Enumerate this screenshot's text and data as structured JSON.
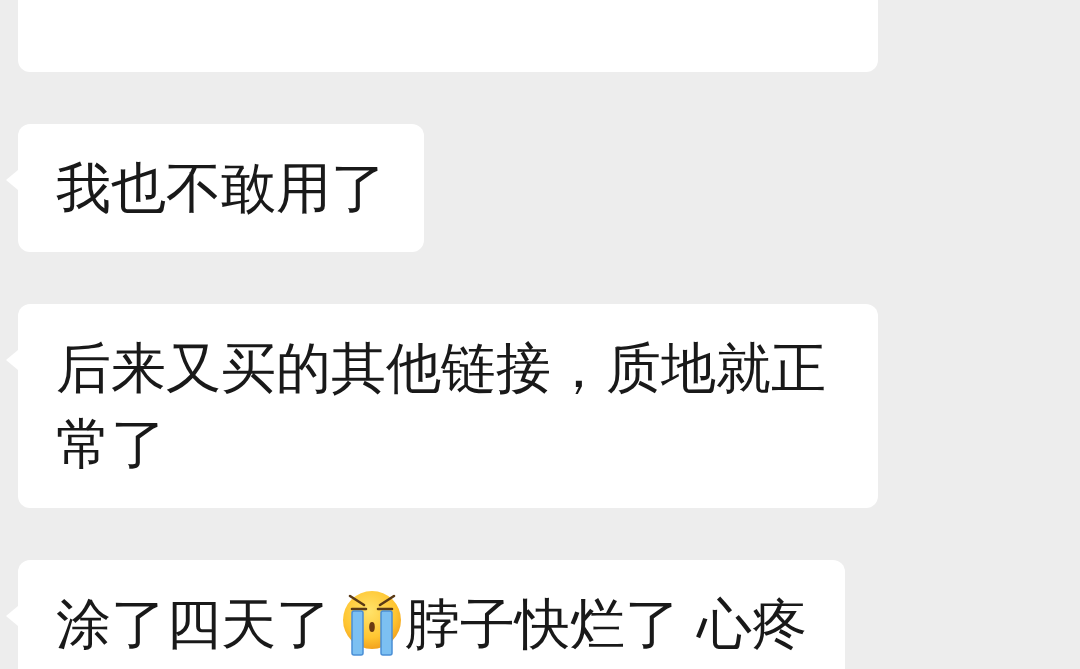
{
  "messages": [
    {
      "cut_off_top": true
    },
    {
      "cut_off_top": false,
      "segments": [
        {
          "kind": "text",
          "text": "我也不敢用了"
        }
      ]
    },
    {
      "cut_off_top": false,
      "segments": [
        {
          "kind": "text",
          "text": "后来又买的其他链接，质地就正常了"
        }
      ]
    },
    {
      "cut_off_top": false,
      "segments": [
        {
          "kind": "text",
          "text": "涂了四天了"
        },
        {
          "kind": "emoji"
        },
        {
          "kind": "text",
          "text": "脖子快烂了 心疼"
        }
      ]
    }
  ]
}
